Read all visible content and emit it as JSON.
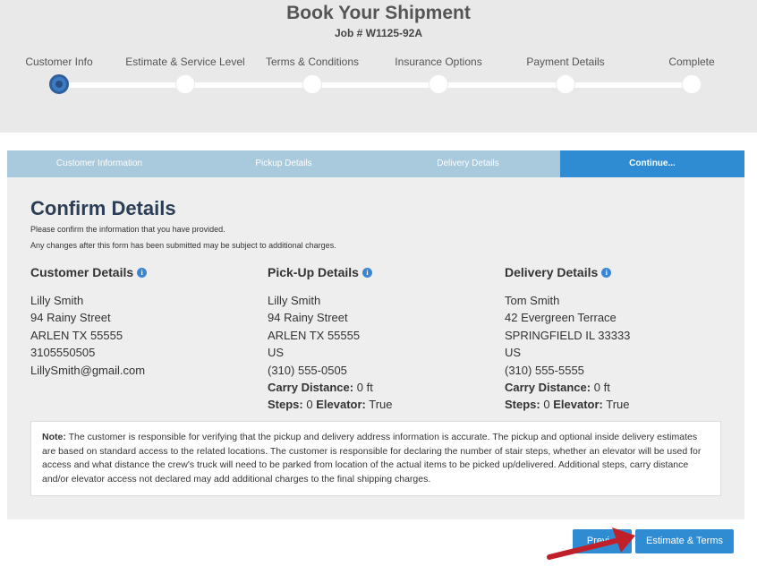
{
  "header": {
    "title": "Book Your Shipment",
    "job": "Job # W1125-92A"
  },
  "progress": {
    "steps": [
      {
        "label": "Customer Info",
        "active": true
      },
      {
        "label": "Estimate & Service Level",
        "active": false
      },
      {
        "label": "Terms & Conditions",
        "active": false
      },
      {
        "label": "Insurance Options",
        "active": false
      },
      {
        "label": "Payment Details",
        "active": false
      },
      {
        "label": "Complete",
        "active": false
      }
    ]
  },
  "tabs": [
    {
      "label": "Customer Information",
      "active": false
    },
    {
      "label": "Pickup Details",
      "active": false
    },
    {
      "label": "Delivery Details",
      "active": false
    },
    {
      "label": "Continue...",
      "active": true
    }
  ],
  "confirm": {
    "title": "Confirm Details",
    "intro1": "Please confirm the information that you have provided.",
    "intro2": "Any changes after this form has been submitted may be subject to additional charges."
  },
  "customer": {
    "heading": "Customer Details",
    "name": "Lilly Smith",
    "street": "94 Rainy Street",
    "city": "ARLEN TX 55555",
    "phone": "3105550505",
    "email": "LillySmith@gmail.com"
  },
  "pickup": {
    "heading": "Pick-Up Details",
    "name": "Lilly Smith",
    "street": "94 Rainy Street",
    "city": "ARLEN TX 55555",
    "country": "US",
    "phone": "(310) 555-0505",
    "carry_label": "Carry Distance:",
    "carry_value": "0 ft",
    "steps_label": "Steps:",
    "steps_value": "0",
    "elevator_label": "Elevator:",
    "elevator_value": "True"
  },
  "delivery": {
    "heading": "Delivery Details",
    "name": "Tom Smith",
    "street": "42 Evergreen Terrace",
    "city": "SPRINGFIELD IL 33333",
    "country": "US",
    "phone": "(310) 555-5555",
    "carry_label": "Carry Distance:",
    "carry_value": "0 ft",
    "steps_label": "Steps:",
    "steps_value": "0",
    "elevator_label": "Elevator:",
    "elevator_value": "True"
  },
  "note": {
    "label": "Note:",
    "text": "The customer is responsible for verifying that the pickup and delivery address information is accurate. The pickup and optional inside delivery estimates are based on standard access to the related locations. The customer is responsible for declaring the number of stair steps, whether an elevator will be used for access and what distance the crew's truck will need to be parked from location of the actual items to be picked up/delivered. Additional steps, carry distance and/or elevator access not declared may add additional charges to the final shipping charges."
  },
  "buttons": {
    "previous": "Previ...",
    "next": "Estimate & Terms"
  },
  "colors": {
    "accent": "#2f8bd2",
    "arrow": "#c0202a"
  }
}
